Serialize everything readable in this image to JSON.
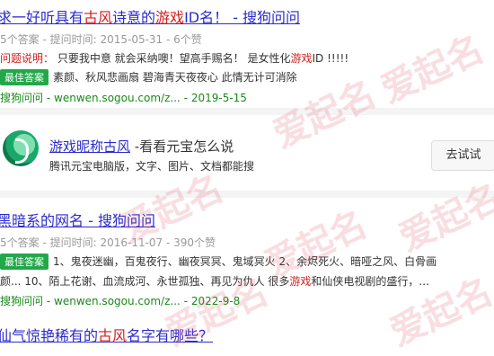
{
  "results": [
    {
      "title_pre": "求一好听具有",
      "title_hl1": "古风",
      "title_mid": "诗意的",
      "title_hl2": "游戏",
      "title_post": "ID名！ - 搜狗问问",
      "meta": "5个答案 - 提问时间: 2015-05-31 - 6个赞",
      "desc_label": "问题说明：",
      "desc_pre": "只要我中意 就会采纳噢！望高手赐名！ 是女性化",
      "desc_hl": "游戏",
      "desc_post": "ID !!!!!",
      "badge": "最佳答案",
      "answer": "素颜、秋风悲画扇 碧海青天夜夜心 此情无计可消除",
      "source_site": "搜狗问问",
      "source_url": "wenwen.sogou.com/z...",
      "source_date": "2019-5-15"
    },
    {
      "title": "黑暗系的网名 - 搜狗问问",
      "meta": "5个答案 - 提问时间: 2016-11-07 - 390个赞",
      "badge": "最佳答案",
      "answer_1": "1、鬼夜迷幽，百鬼夜行、幽夜冥冥、鬼域冥火 2、余烬死火、暗哑之风、白骨画",
      "answer_2_pre": "颜... 10、陌上花谢、血流成河、永世孤独、再见为仇人 很多",
      "answer_2_hl": "游戏",
      "answer_2_post": "和仙侠电视剧的盛行，...",
      "source_site": "搜狗问问",
      "source_url": "wenwen.sogou.com/z...",
      "source_date": "2022-9-8"
    },
    {
      "title_pre": "仙气惊艳稀有的",
      "title_hl1": "古风",
      "title_post": "名字有哪些？"
    }
  ],
  "ad": {
    "title_hl": "游戏昵称古风",
    "title_post": " -看看元宝怎么说",
    "desc": "腾讯元宝电脑版，文字、图片、文档都能搜",
    "button": "去试试"
  },
  "watermark": "爱起名",
  "colors": {
    "link": "#2b2bcc",
    "highlight": "#d21e1e",
    "badge": "#22a84a",
    "source": "#1a8a1a"
  }
}
